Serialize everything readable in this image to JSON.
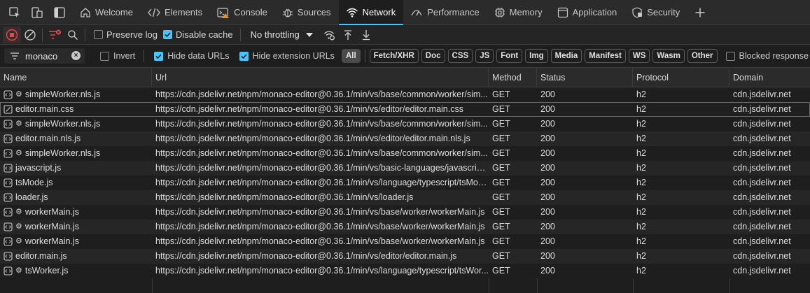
{
  "tabs": [
    {
      "label": "Welcome",
      "icon": "home-icon",
      "active": false
    },
    {
      "label": "Elements",
      "icon": "code-icon",
      "active": false
    },
    {
      "label": "Console",
      "icon": "console-icon",
      "active": false
    },
    {
      "label": "Sources",
      "icon": "bug-icon",
      "active": false
    },
    {
      "label": "Network",
      "icon": "wifi-icon",
      "active": true
    },
    {
      "label": "Performance",
      "icon": "performance-icon",
      "active": false
    },
    {
      "label": "Memory",
      "icon": "memory-icon",
      "active": false
    },
    {
      "label": "Application",
      "icon": "application-icon",
      "active": false
    },
    {
      "label": "Security",
      "icon": "shield-icon",
      "active": false
    }
  ],
  "toolbar": {
    "preserve_log_label": "Preserve log",
    "preserve_log_checked": false,
    "disable_cache_label": "Disable cache",
    "disable_cache_checked": true,
    "throttling_label": "No throttling"
  },
  "filter": {
    "value": "monaco",
    "invert_label": "Invert",
    "invert_checked": false,
    "hide_data_urls_label": "Hide data URLs",
    "hide_data_urls_checked": true,
    "hide_extension_urls_label": "Hide extension URLs",
    "hide_extension_urls_checked": true,
    "types": [
      "All",
      "Fetch/XHR",
      "Doc",
      "CSS",
      "JS",
      "Font",
      "Img",
      "Media",
      "Manifest",
      "WS",
      "Wasm",
      "Other"
    ],
    "blocked_response_label": "Blocked response"
  },
  "columns": {
    "name": "Name",
    "url": "Url",
    "method": "Method",
    "status": "Status",
    "protocol": "Protocol",
    "domain": "Domain"
  },
  "rows": [
    {
      "name": "simpleWorker.nls.js",
      "worker": true,
      "type": "script",
      "url": "https://cdn.jsdelivr.net/npm/monaco-editor@0.36.1/min/vs/base/common/worker/sim...",
      "method": "GET",
      "status": "200",
      "protocol": "h2",
      "domain": "cdn.jsdelivr.net"
    },
    {
      "name": "editor.main.css",
      "worker": false,
      "type": "stylesheet",
      "selected": true,
      "url": "https://cdn.jsdelivr.net/npm/monaco-editor@0.36.1/min/vs/editor/editor.main.css",
      "method": "GET",
      "status": "200",
      "protocol": "h2",
      "domain": "cdn.jsdelivr.net"
    },
    {
      "name": "simpleWorker.nls.js",
      "worker": true,
      "type": "script",
      "url": "https://cdn.jsdelivr.net/npm/monaco-editor@0.36.1/min/vs/base/common/worker/sim...",
      "method": "GET",
      "status": "200",
      "protocol": "h2",
      "domain": "cdn.jsdelivr.net"
    },
    {
      "name": "editor.main.nls.js",
      "worker": false,
      "type": "script",
      "url": "https://cdn.jsdelivr.net/npm/monaco-editor@0.36.1/min/vs/editor/editor.main.nls.js",
      "method": "GET",
      "status": "200",
      "protocol": "h2",
      "domain": "cdn.jsdelivr.net"
    },
    {
      "name": "simpleWorker.nls.js",
      "worker": true,
      "type": "script",
      "url": "https://cdn.jsdelivr.net/npm/monaco-editor@0.36.1/min/vs/base/common/worker/sim...",
      "method": "GET",
      "status": "200",
      "protocol": "h2",
      "domain": "cdn.jsdelivr.net"
    },
    {
      "name": "javascript.js",
      "worker": false,
      "type": "script",
      "url": "https://cdn.jsdelivr.net/npm/monaco-editor@0.36.1/min/vs/basic-languages/javascript...",
      "method": "GET",
      "status": "200",
      "protocol": "h2",
      "domain": "cdn.jsdelivr.net"
    },
    {
      "name": "tsMode.js",
      "worker": false,
      "type": "script",
      "url": "https://cdn.jsdelivr.net/npm/monaco-editor@0.36.1/min/vs/language/typescript/tsMod...",
      "method": "GET",
      "status": "200",
      "protocol": "h2",
      "domain": "cdn.jsdelivr.net"
    },
    {
      "name": "loader.js",
      "worker": false,
      "type": "script",
      "url": "https://cdn.jsdelivr.net/npm/monaco-editor@0.36.1/min/vs/loader.js",
      "method": "GET",
      "status": "200",
      "protocol": "h2",
      "domain": "cdn.jsdelivr.net"
    },
    {
      "name": "workerMain.js",
      "worker": true,
      "type": "script",
      "url": "https://cdn.jsdelivr.net/npm/monaco-editor@0.36.1/min/vs/base/worker/workerMain.js",
      "method": "GET",
      "status": "200",
      "protocol": "h2",
      "domain": "cdn.jsdelivr.net"
    },
    {
      "name": "workerMain.js",
      "worker": true,
      "type": "script",
      "url": "https://cdn.jsdelivr.net/npm/monaco-editor@0.36.1/min/vs/base/worker/workerMain.js",
      "method": "GET",
      "status": "200",
      "protocol": "h2",
      "domain": "cdn.jsdelivr.net"
    },
    {
      "name": "workerMain.js",
      "worker": true,
      "type": "script",
      "url": "https://cdn.jsdelivr.net/npm/monaco-editor@0.36.1/min/vs/base/worker/workerMain.js",
      "method": "GET",
      "status": "200",
      "protocol": "h2",
      "domain": "cdn.jsdelivr.net"
    },
    {
      "name": "editor.main.js",
      "worker": false,
      "type": "script",
      "url": "https://cdn.jsdelivr.net/npm/monaco-editor@0.36.1/min/vs/editor/editor.main.js",
      "method": "GET",
      "status": "200",
      "protocol": "h2",
      "domain": "cdn.jsdelivr.net"
    },
    {
      "name": "tsWorker.js",
      "worker": true,
      "type": "script",
      "url": "https://cdn.jsdelivr.net/npm/monaco-editor@0.36.1/min/vs/language/typescript/tsWor...",
      "method": "GET",
      "status": "200",
      "protocol": "h2",
      "domain": "cdn.jsdelivr.net"
    }
  ],
  "colors": {
    "accent": "#4cc2ff",
    "record": "#e5484d",
    "background": "#1e1e1e"
  }
}
